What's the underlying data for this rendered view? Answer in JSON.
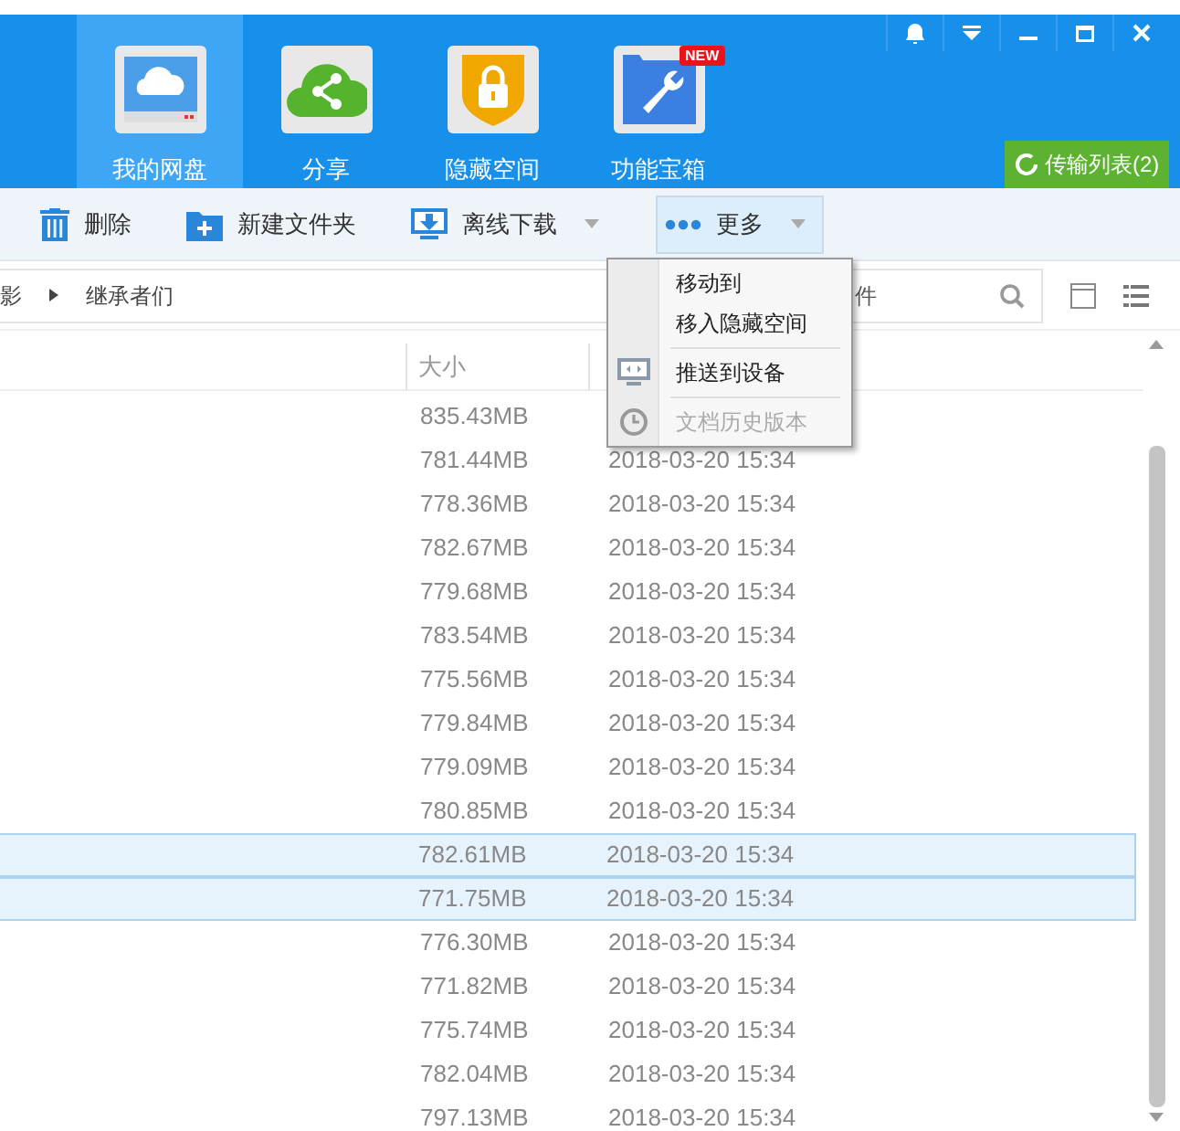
{
  "nav_tabs": [
    {
      "label": "我的网盘",
      "kind": "cloud",
      "selected": true
    },
    {
      "label": "分享",
      "kind": "share",
      "selected": false
    },
    {
      "label": "隐藏空间",
      "kind": "lock",
      "selected": false
    },
    {
      "label": "功能宝箱",
      "kind": "tools",
      "selected": false,
      "badge": "NEW"
    }
  ],
  "transfer_button": "传输列表(2)",
  "toolbar": [
    {
      "label": "删除",
      "kind": "trash",
      "dropdown": false,
      "pressed": false
    },
    {
      "label": "新建文件夹",
      "kind": "folder",
      "dropdown": false,
      "pressed": false
    },
    {
      "label": "离线下载",
      "kind": "download",
      "dropdown": true,
      "pressed": false
    },
    {
      "label": "更多",
      "kind": "dots",
      "dropdown": true,
      "pressed": true
    }
  ],
  "breadcrumb": [
    "影",
    "继承者们"
  ],
  "search": {
    "placeholder": "件"
  },
  "columns": [
    "大小"
  ],
  "rows": [
    {
      "size": "835.43MB",
      "date": "",
      "selected": false
    },
    {
      "size": "781.44MB",
      "date": "2018-03-20 15:34",
      "selected": false
    },
    {
      "size": "778.36MB",
      "date": "2018-03-20 15:34",
      "selected": false
    },
    {
      "size": "782.67MB",
      "date": "2018-03-20 15:34",
      "selected": false
    },
    {
      "size": "779.68MB",
      "date": "2018-03-20 15:34",
      "selected": false
    },
    {
      "size": "783.54MB",
      "date": "2018-03-20 15:34",
      "selected": false
    },
    {
      "size": "775.56MB",
      "date": "2018-03-20 15:34",
      "selected": false
    },
    {
      "size": "779.84MB",
      "date": "2018-03-20 15:34",
      "selected": false
    },
    {
      "size": "779.09MB",
      "date": "2018-03-20 15:34",
      "selected": false
    },
    {
      "size": "780.85MB",
      "date": "2018-03-20 15:34",
      "selected": false
    },
    {
      "size": "782.61MB",
      "date": "2018-03-20 15:34",
      "selected": true
    },
    {
      "size": "771.75MB",
      "date": "2018-03-20 15:34",
      "selected": true
    },
    {
      "size": "776.30MB",
      "date": "2018-03-20 15:34",
      "selected": false
    },
    {
      "size": "771.82MB",
      "date": "2018-03-20 15:34",
      "selected": false
    },
    {
      "size": "775.74MB",
      "date": "2018-03-20 15:34",
      "selected": false
    },
    {
      "size": "782.04MB",
      "date": "2018-03-20 15:34",
      "selected": false
    },
    {
      "size": "797.13MB",
      "date": "2018-03-20 15:34",
      "selected": false
    }
  ],
  "menu": [
    {
      "label": "移动到",
      "kind": "plain",
      "disabled": false,
      "separator_after": false
    },
    {
      "label": "移入隐藏空间",
      "kind": "plain",
      "disabled": false,
      "separator_after": true
    },
    {
      "label": "推送到设备",
      "kind": "monitor",
      "disabled": false,
      "separator_after": true
    },
    {
      "label": "文档历史版本",
      "kind": "clock",
      "disabled": true,
      "separator_after": false
    }
  ]
}
